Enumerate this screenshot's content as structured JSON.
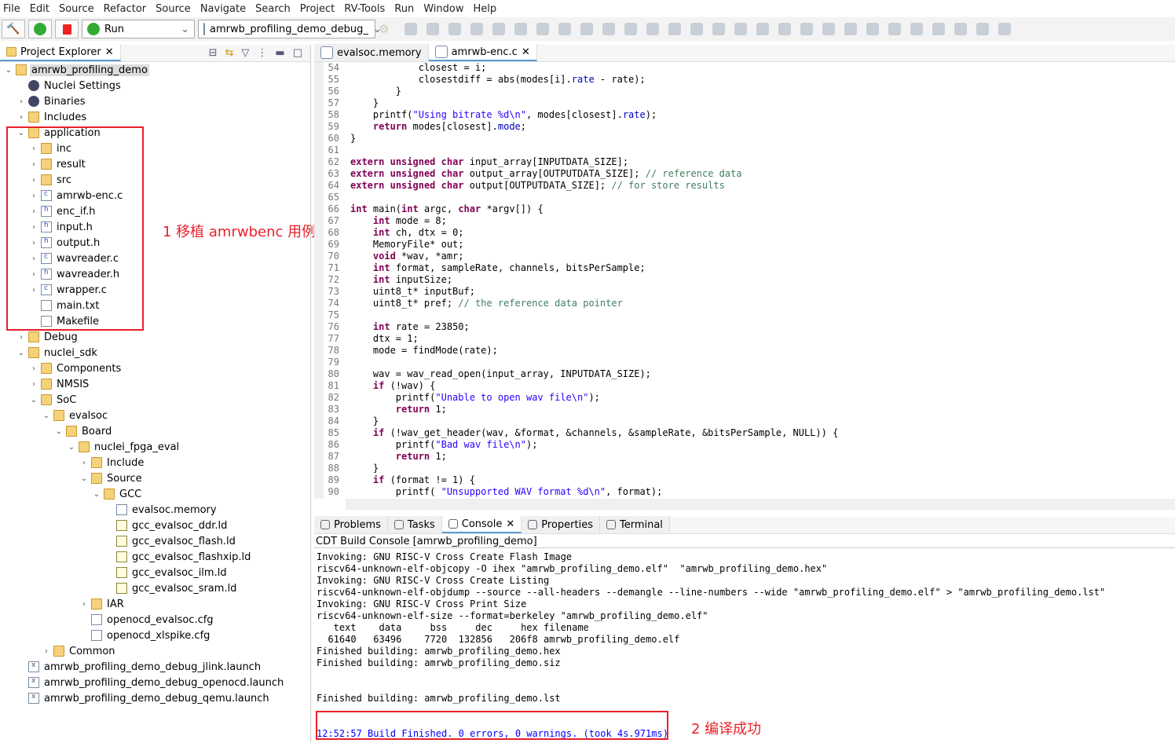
{
  "menu": [
    "File",
    "Edit",
    "Source",
    "Refactor",
    "Source",
    "Navigate",
    "Search",
    "Project",
    "RV-Tools",
    "Run",
    "Window",
    "Help"
  ],
  "toolbar": {
    "run_mode": "Run",
    "launch_config": "amrwb_profiling_demo_debug_"
  },
  "explorer": {
    "title": "Project Explorer",
    "items": [
      {
        "d": 0,
        "c": "v",
        "i": "proj",
        "t": "amrwb_profiling_demo",
        "sel": true
      },
      {
        "d": 1,
        "c": "",
        "i": "gear",
        "t": "Nuclei Settings"
      },
      {
        "d": 1,
        "c": ">",
        "i": "gear",
        "t": "Binaries"
      },
      {
        "d": 1,
        "c": ">",
        "i": "folder",
        "t": "Includes"
      },
      {
        "d": 1,
        "c": "v",
        "i": "folder",
        "t": "application"
      },
      {
        "d": 2,
        "c": ">",
        "i": "folder",
        "t": "inc"
      },
      {
        "d": 2,
        "c": ">",
        "i": "folder",
        "t": "result"
      },
      {
        "d": 2,
        "c": ">",
        "i": "folder",
        "t": "src"
      },
      {
        "d": 2,
        "c": ">",
        "i": "file filec",
        "t": "amrwb-enc.c"
      },
      {
        "d": 2,
        "c": ">",
        "i": "file fileh",
        "t": "enc_if.h"
      },
      {
        "d": 2,
        "c": ">",
        "i": "file fileh",
        "t": "input.h"
      },
      {
        "d": 2,
        "c": ">",
        "i": "file fileh",
        "t": "output.h"
      },
      {
        "d": 2,
        "c": ">",
        "i": "file filec",
        "t": "wavreader.c"
      },
      {
        "d": 2,
        "c": ">",
        "i": "file fileh",
        "t": "wavreader.h"
      },
      {
        "d": 2,
        "c": ">",
        "i": "file filec",
        "t": "wrapper.c"
      },
      {
        "d": 2,
        "c": "",
        "i": "file",
        "t": "main.txt"
      },
      {
        "d": 2,
        "c": "",
        "i": "file",
        "t": "Makefile"
      },
      {
        "d": 1,
        "c": ">",
        "i": "folder",
        "t": "Debug"
      },
      {
        "d": 1,
        "c": "v",
        "i": "folder",
        "t": "nuclei_sdk"
      },
      {
        "d": 2,
        "c": ">",
        "i": "folder",
        "t": "Components"
      },
      {
        "d": 2,
        "c": ">",
        "i": "folder",
        "t": "NMSIS"
      },
      {
        "d": 2,
        "c": "v",
        "i": "folder",
        "t": "SoC"
      },
      {
        "d": 3,
        "c": "v",
        "i": "folder",
        "t": "evalsoc"
      },
      {
        "d": 4,
        "c": "v",
        "i": "folder",
        "t": "Board"
      },
      {
        "d": 5,
        "c": "v",
        "i": "folder",
        "t": "nuclei_fpga_eval"
      },
      {
        "d": 6,
        "c": ">",
        "i": "folder",
        "t": "Include"
      },
      {
        "d": 6,
        "c": "v",
        "i": "folder",
        "t": "Source"
      },
      {
        "d": 7,
        "c": "v",
        "i": "folder",
        "t": "GCC"
      },
      {
        "d": 8,
        "c": "",
        "i": "file",
        "t": "evalsoc.memory"
      },
      {
        "d": 8,
        "c": "",
        "i": "ld",
        "t": "gcc_evalsoc_ddr.ld"
      },
      {
        "d": 8,
        "c": "",
        "i": "ld",
        "t": "gcc_evalsoc_flash.ld"
      },
      {
        "d": 8,
        "c": "",
        "i": "ld",
        "t": "gcc_evalsoc_flashxip.ld"
      },
      {
        "d": 8,
        "c": "",
        "i": "ld",
        "t": "gcc_evalsoc_ilm.ld"
      },
      {
        "d": 8,
        "c": "",
        "i": "ld",
        "t": "gcc_evalsoc_sram.ld"
      },
      {
        "d": 6,
        "c": ">",
        "i": "folder",
        "t": "IAR"
      },
      {
        "d": 6,
        "c": "",
        "i": "file",
        "t": "openocd_evalsoc.cfg"
      },
      {
        "d": 6,
        "c": "",
        "i": "file",
        "t": "openocd_xlspike.cfg"
      },
      {
        "d": 3,
        "c": ">",
        "i": "folder",
        "t": "Common"
      },
      {
        "d": 1,
        "c": "",
        "i": "file filex",
        "t": "amrwb_profiling_demo_debug_jlink.launch"
      },
      {
        "d": 1,
        "c": "",
        "i": "file filex",
        "t": "amrwb_profiling_demo_debug_openocd.launch"
      },
      {
        "d": 1,
        "c": "",
        "i": "file filex",
        "t": "amrwb_profiling_demo_debug_qemu.launch"
      }
    ]
  },
  "editor": {
    "tabs": [
      "evalsoc.memory",
      "amrwb-enc.c"
    ],
    "first_line": 54,
    "lines": [
      "            closest = i;",
      "            closestdiff = abs(modes[i].rate - rate);",
      "        }",
      "    }",
      "    printf(\"Using bitrate %d\\n\", modes[closest].rate);",
      "    return modes[closest].mode;",
      "}",
      "",
      "extern unsigned char input_array[INPUTDATA_SIZE];",
      "extern unsigned char output_array[OUTPUTDATA_SIZE]; // reference data",
      "extern unsigned char output[OUTPUTDATA_SIZE]; // for store results",
      "",
      "int main(int argc, char *argv[]) {",
      "    int mode = 8;",
      "    int ch, dtx = 0;",
      "    MemoryFile* out;",
      "    void *wav, *amr;",
      "    int format, sampleRate, channels, bitsPerSample;",
      "    int inputSize;",
      "    uint8_t* inputBuf;",
      "    uint8_t* pref; // the reference data pointer",
      "",
      "    int rate = 23850;",
      "    dtx = 1;",
      "    mode = findMode(rate);",
      "",
      "    wav = wav_read_open(input_array, INPUTDATA_SIZE);",
      "    if (!wav) {",
      "        printf(\"Unable to open wav file\\n\");",
      "        return 1;",
      "    }",
      "    if (!wav_get_header(wav, &format, &channels, &sampleRate, &bitsPerSample, NULL)) {",
      "        printf(\"Bad wav file\\n\");",
      "        return 1;",
      "    }",
      "    if (format != 1) {",
      "        printf( \"Unsupported WAV format %d\\n\", format);"
    ]
  },
  "bottom": {
    "tabs": [
      "Problems",
      "Tasks",
      "Console",
      "Properties",
      "Terminal"
    ],
    "console_title": "CDT Build Console [amrwb_profiling_demo]",
    "lines": [
      "Invoking: GNU RISC-V Cross Create Flash Image",
      "riscv64-unknown-elf-objcopy -O ihex \"amrwb_profiling_demo.elf\"  \"amrwb_profiling_demo.hex\"",
      "Invoking: GNU RISC-V Cross Create Listing",
      "riscv64-unknown-elf-objdump --source --all-headers --demangle --line-numbers --wide \"amrwb_profiling_demo.elf\" > \"amrwb_profiling_demo.lst\"",
      "Invoking: GNU RISC-V Cross Print Size",
      "riscv64-unknown-elf-size --format=berkeley \"amrwb_profiling_demo.elf\"",
      "   text    data     bss     dec     hex filename",
      "  61640   63496    7720  132856   206f8 amrwb_profiling_demo.elf",
      "Finished building: amrwb_profiling_demo.hex",
      "Finished building: amrwb_profiling_demo.siz",
      "",
      "",
      "Finished building: amrwb_profiling_demo.lst",
      "",
      ""
    ],
    "final": "12:52:57 Build Finished. 0 errors, 0 warnings. (took 4s.971ms)"
  },
  "annotations": {
    "a1": "1 移植 amrwbenc 用例",
    "a2": "2 编译成功"
  },
  "colors": {
    "annotation": "#e8202a",
    "keyword": "#7f0055",
    "string": "#2a00ff",
    "comment": "#3f7f5f",
    "final_line": "#0000ff"
  }
}
